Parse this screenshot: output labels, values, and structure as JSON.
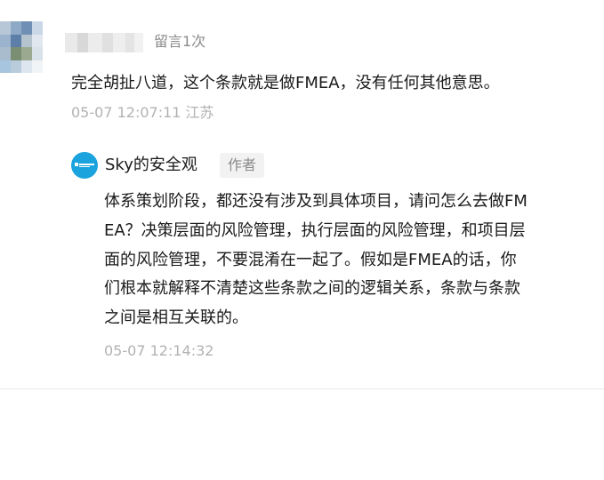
{
  "comment": {
    "reply_count_label": "留言1次",
    "text": "完全胡扯八道，这个条款就是做FMEA，没有任何其他意思。",
    "meta": "05-07 12:07:11 江苏"
  },
  "reply": {
    "author_name": "Sky的安全观",
    "author_badge": "作者",
    "lines": [
      "体系策划阶段，都还没有涉及到具体项目，请问怎么去做FM",
      "EA？决策层面的风险管理，执行层面的风险管理，和项目层",
      "面的风险管理，不要混淆在一起了。假如是FMEA的话，你",
      "们根本就解释不清楚这些条款之间的逻辑关系，条款与条款",
      "之间是相互关联的。"
    ],
    "meta": "05-07 12:14:32"
  },
  "colors": {
    "accent": "#1aa3dc",
    "meta_gray": "#b2b2b2",
    "badge_bg": "#f2f2f2"
  }
}
